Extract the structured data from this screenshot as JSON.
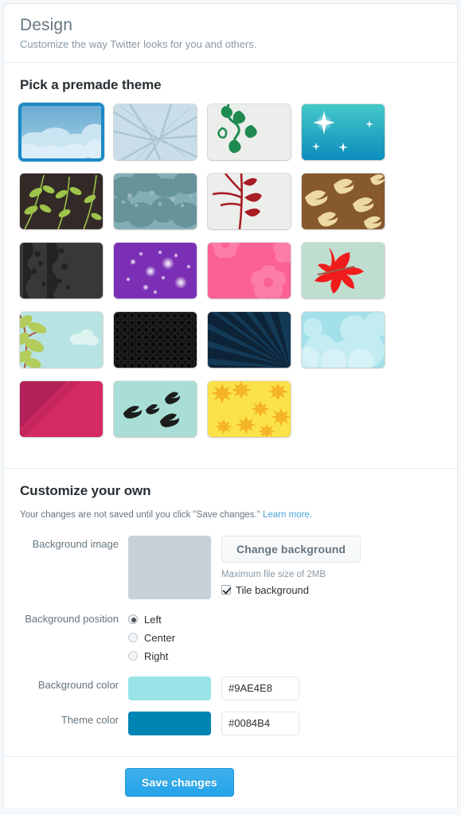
{
  "page": {
    "title": "Design",
    "subtitle": "Customize the way Twitter looks for you and others."
  },
  "premade": {
    "heading": "Pick a premade theme",
    "selected_index": 0,
    "themes": [
      {
        "name": "clouds-blue-sky",
        "bg": "#7fb8d8"
      },
      {
        "name": "bare-branches",
        "bg": "#c5dce8"
      },
      {
        "name": "green-ivy-vine",
        "bg": "#eceeeb"
      },
      {
        "name": "teal-sparkle",
        "bg": "#1ba9cd"
      },
      {
        "name": "green-leaves-brown",
        "bg": "#332a28"
      },
      {
        "name": "misty-treetops",
        "bg": "#74a3ac"
      },
      {
        "name": "red-wheat-stalk",
        "bg": "#eceeeb"
      },
      {
        "name": "birds-on-brown",
        "bg": "#87592e"
      },
      {
        "name": "dark-forest-night",
        "bg": "#333333"
      },
      {
        "name": "purple-starfield",
        "bg": "#7b2fb5"
      },
      {
        "name": "pink-flowers",
        "bg": "#fc6194"
      },
      {
        "name": "red-maple-leaf",
        "bg": "#bfded0"
      },
      {
        "name": "leaves-and-cloud",
        "bg": "#b7e4e3"
      },
      {
        "name": "black-carbon-dots",
        "bg": "#141414"
      },
      {
        "name": "navy-sunburst",
        "bg": "#0d2438"
      },
      {
        "name": "pale-blue-clouds",
        "bg": "#a9e3ec"
      },
      {
        "name": "magenta-diagonal",
        "bg": "#c2255c"
      },
      {
        "name": "birds-in-flight",
        "bg": "#a8ded6"
      },
      {
        "name": "yellow-maple-leaves",
        "bg": "#fbe14a"
      }
    ]
  },
  "customize": {
    "heading": "Customize your own",
    "note_text": "Your changes are not saved until you click \"Save changes.\" ",
    "note_link": "Learn more.",
    "background_image": {
      "label": "Background image",
      "button_label": "Change background",
      "hint": "Maximum file size of 2MB",
      "tile_label": "Tile background",
      "tile_checked": true,
      "preview_color": "#c7d2d8"
    },
    "background_position": {
      "label": "Background position",
      "selected": "Left",
      "options": [
        "Left",
        "Center",
        "Right"
      ]
    },
    "background_color": {
      "label": "Background color",
      "value": "#9AE4E8",
      "swatch": "#9ae4e8"
    },
    "theme_color": {
      "label": "Theme color",
      "value": "#0084B4",
      "swatch": "#0084b4"
    }
  },
  "footer": {
    "save_label": "Save changes"
  }
}
